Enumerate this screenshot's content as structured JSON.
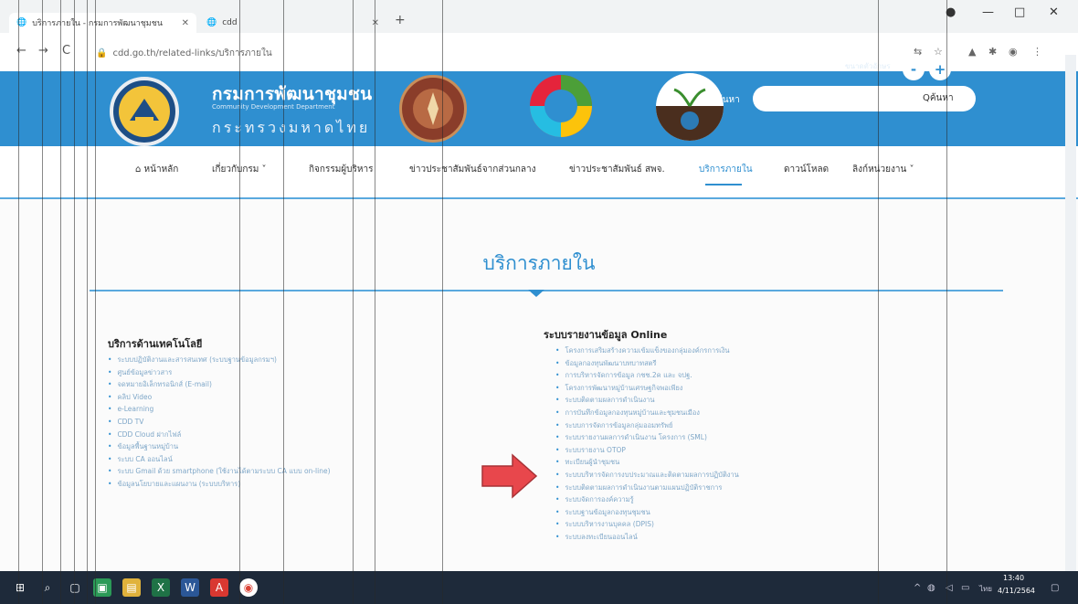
{
  "browser": {
    "tabs": [
      {
        "title": "บริการภายใน - กรมการพัฒนาชุมชน",
        "active": true
      },
      {
        "title": "cdd",
        "active": false
      }
    ],
    "url": "cdd.go.th/related-links/บริการภายใน",
    "new_tab_icon": "plus"
  },
  "site": {
    "org_name_th": "กรมการพัฒนาชุมชน",
    "org_name_en": "Community Development Department",
    "ministry": "กระทรวงมหาดไทย",
    "search_label": "ค้นหา",
    "search_placeholder": "",
    "search_button": "Qค้นหา",
    "zoom_minus": "-",
    "zoom_plus": "+",
    "zoom_label": "ขนาดตัวอักษร"
  },
  "nav": {
    "items": [
      {
        "label": "หน้าหลัก",
        "icon": "home"
      },
      {
        "label": "เกี่ยวกับกรม ˅"
      },
      {
        "label": "กิจกรรมผู้บริหาร"
      },
      {
        "label": "ข่าวประชาสัมพันธ์จากส่วนกลาง"
      },
      {
        "label": "ข่าวประชาสัมพันธ์ สพจ."
      },
      {
        "label": "บริการภายใน",
        "active": true
      },
      {
        "label": "ดาวน์โหลด"
      },
      {
        "label": "ลิงก์หน่วยงาน ˅"
      }
    ]
  },
  "main": {
    "title": "บริการภายใน",
    "left_column": {
      "heading": "บริการด้านเทคโนโลยี",
      "links": [
        "ระบบปฏิบัติงานและสารสนเทศ (ระบบฐานข้อมูลกรมฯ)",
        "ศูนย์ข้อมูลข่าวสาร",
        "จดหมายอิเล็กทรอนิกส์ (E-mail)",
        "คลิป Video",
        "e-Learning",
        "CDD TV",
        "CDD Cloud ฝากไฟล์",
        "ข้อมูลพื้นฐานหมู่บ้าน",
        "ระบบ CA ออนไลน์",
        "ระบบ Gmail ด้วย smartphone (ใช้งานได้ตามระบบ CA แบบ on-line)",
        "ข้อมูลนโยบายและแผนงาน (ระบบบริหาร)"
      ]
    },
    "right_column": {
      "heading": "ระบบรายงานข้อมูล Online",
      "links": [
        "โครงการเสริมสร้างความเข้มแข็งของกลุ่มองค์กรการเงิน",
        "ข้อมูลกองทุนพัฒนาบทบาทสตรี",
        "การบริหารจัดการข้อมูล กชช.2ค และ จปฐ.",
        "โครงการพัฒนาหมู่บ้านเศรษฐกิจพอเพียง",
        "ระบบติดตามผลการดำเนินงาน",
        "การบันทึกข้อมูลกองทุนหมู่บ้านและชุมชนเมือง",
        "ระบบการจัดการข้อมูลกลุ่มออมทรัพย์",
        "ระบบรายงานผลการดำเนินงาน โครงการ (SML)",
        "ระบบรายงาน OTOP",
        "ทะเบียนผู้นำชุมชน",
        "ระบบบริหารจัดการงบประมาณและติดตามผลการปฏิบัติงาน",
        "ระบบติดตามผลการดำเนินงานตามแผนปฏิบัติราชการ",
        "ระบบจัดการองค์ความรู้",
        "ระบบฐานข้อมูลกองทุนชุมชน",
        "ระบบบริหารงานบุคคล (DPIS)",
        "ระบบลงทะเบียนออนไลน์"
      ]
    }
  },
  "taskbar": {
    "time": "13:40",
    "date": "4/11/2564",
    "lang": "ไทย",
    "apps": [
      "start-icon",
      "search-icon",
      "task-view-icon",
      "store-icon",
      "files-icon",
      "excel-icon",
      "word-icon",
      "pdf-icon",
      "chrome-icon"
    ]
  },
  "annotation": {
    "arrow_color": "#e8474c"
  },
  "colors": {
    "brand_blue": "#2f8fd0",
    "taskbar": "#1e2a3a"
  }
}
